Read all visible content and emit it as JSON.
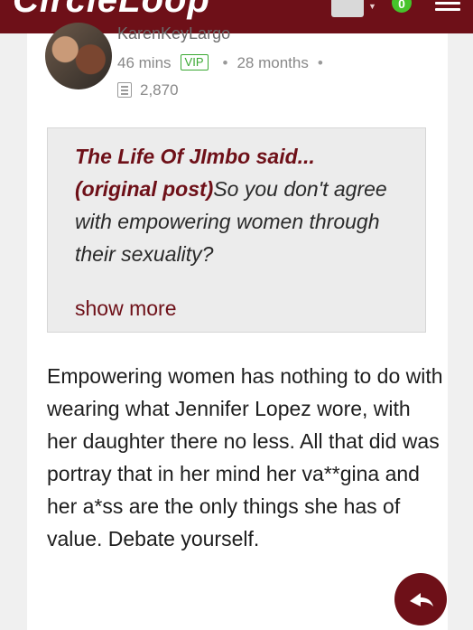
{
  "header": {
    "logo_text": "CircleLoop",
    "notification_count": "0"
  },
  "post": {
    "author": "KarenKeyLargo",
    "time_ago": "46 mins",
    "badge": "VIP",
    "member_for": "28 months",
    "view_count": "2,870"
  },
  "quote": {
    "author_said": "The Life Of JImbo said...",
    "original_label": "(original post)",
    "text": "So you don't agree with empowering women through their sexuality?",
    "show_more": "show more"
  },
  "body": {
    "text": "Empowering women has nothing to do with wearing what Jennifer Lopez wore, with her daughter there no less. All that did was portray that in her mind her va**gina and her a*ss are the only things she has of value. Debate yourself."
  },
  "colors": {
    "brand": "#6e1018",
    "badge_green": "#46c32b"
  }
}
